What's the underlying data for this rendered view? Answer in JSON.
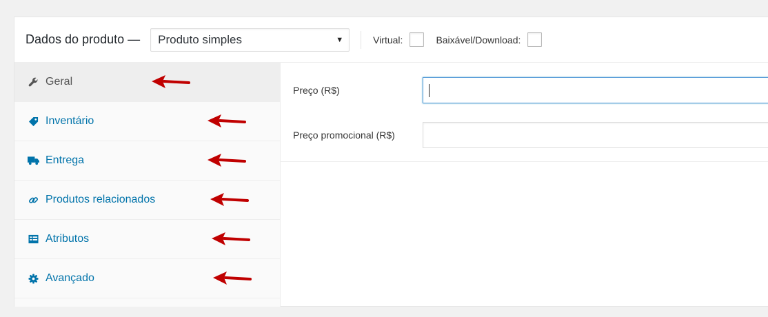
{
  "header": {
    "title": "Dados do produto —",
    "product_type": {
      "selected": "Produto simples"
    },
    "virtual_label": "Virtual:",
    "download_label": "Baixável/Download:"
  },
  "tabs": [
    {
      "label": "Geral",
      "icon": "wrench-icon",
      "active": true
    },
    {
      "label": "Inventário",
      "icon": "tag-icon",
      "active": false
    },
    {
      "label": "Entrega",
      "icon": "truck-icon",
      "active": false
    },
    {
      "label": "Produtos relacionados",
      "icon": "link-icon",
      "active": false
    },
    {
      "label": "Atributos",
      "icon": "list-table-icon",
      "active": false
    },
    {
      "label": "Avançado",
      "icon": "gear-icon",
      "active": false
    }
  ],
  "general": {
    "price_label": "Preço (R$)",
    "price_value": "",
    "sale_price_label": "Preço promocional (R$)",
    "sale_price_value": ""
  },
  "colors": {
    "link": "#0073aa",
    "annotation_arrow": "#c00000",
    "focus": "#5b9dd9"
  }
}
